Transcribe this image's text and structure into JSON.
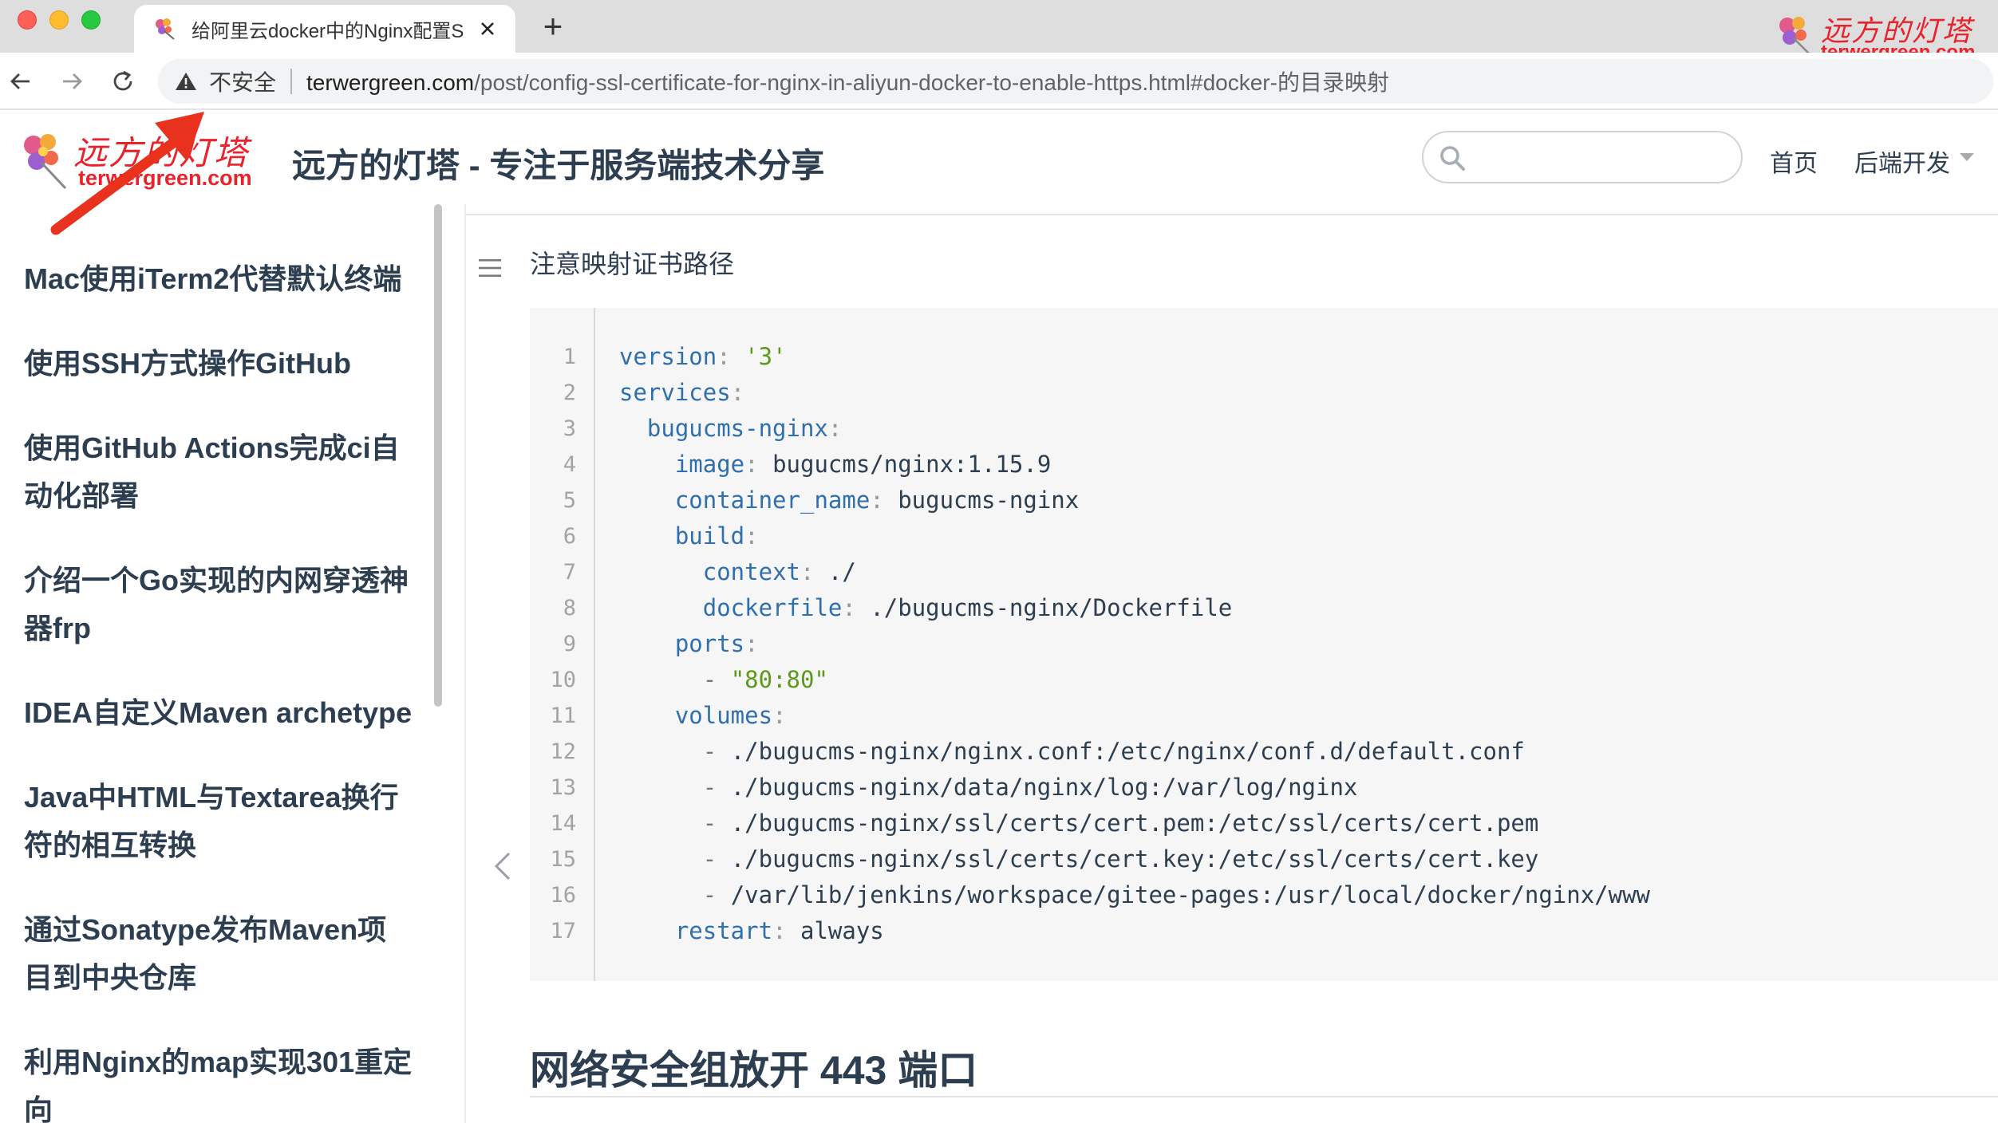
{
  "browser": {
    "tab": {
      "title": "给阿里云docker中的Nginx配置S"
    },
    "new_tab": "+",
    "brand": {
      "cn": "远方的灯塔",
      "en": "terwergreen.com"
    },
    "address": {
      "security_label": "不安全",
      "host": "terwergreen.com",
      "path": "/post/config-ssl-certificate-for-nginx-in-aliyun-docker-to-enable-https.html#docker-的目录映射"
    }
  },
  "site": {
    "logo": {
      "cn": "远方的灯塔",
      "en": "terwergreen.com"
    },
    "title": "远方的灯塔 - 专注于服务端技术分享",
    "search": {
      "placeholder": ""
    },
    "nav": [
      {
        "label": "首页"
      },
      {
        "label": "后端开发"
      }
    ]
  },
  "sidebar": {
    "items": [
      {
        "lines": [
          "Mac使用iTerm2代替默认终端"
        ]
      },
      {
        "lines": [
          "使用SSH方式操作GitHub"
        ]
      },
      {
        "lines": [
          "使用GitHub Actions完成ci自",
          "动化部署"
        ]
      },
      {
        "lines": [
          "介绍一个Go实现的内网穿透神",
          "器frp"
        ]
      },
      {
        "lines": [
          "IDEA自定义Maven archetype"
        ]
      },
      {
        "lines": [
          "Java中HTML与Textarea换行",
          "符的相互转换"
        ]
      },
      {
        "lines": [
          "通过Sonatype发布Maven项",
          "目到中央仓库"
        ]
      },
      {
        "lines": [
          "利用Nginx的map实现301重定",
          "向"
        ]
      }
    ]
  },
  "content": {
    "note": "注意映射证书路径",
    "code": [
      {
        "n": "1",
        "indent": "",
        "key": "version",
        "value": "'3'",
        "vtype": "string"
      },
      {
        "n": "2",
        "indent": "",
        "key": "services",
        "value": "",
        "vtype": "plain"
      },
      {
        "n": "3",
        "indent": "  ",
        "key": "bugucms-nginx",
        "value": "",
        "vtype": "plain"
      },
      {
        "n": "4",
        "indent": "    ",
        "key": "image",
        "value": "bugucms/nginx:1.15.9",
        "vtype": "plain"
      },
      {
        "n": "5",
        "indent": "    ",
        "key": "container_name",
        "value": "bugucms-nginx",
        "vtype": "plain"
      },
      {
        "n": "6",
        "indent": "    ",
        "key": "build",
        "value": "",
        "vtype": "plain"
      },
      {
        "n": "7",
        "indent": "      ",
        "key": "context",
        "value": "./",
        "vtype": "plain"
      },
      {
        "n": "8",
        "indent": "      ",
        "key": "dockerfile",
        "value": "./bugucms-nginx/Dockerfile",
        "vtype": "plain"
      },
      {
        "n": "9",
        "indent": "    ",
        "key": "ports",
        "value": "",
        "vtype": "plain"
      },
      {
        "n": "10",
        "indent": "      ",
        "dash": true,
        "value": "\"80:80\"",
        "vtype": "string"
      },
      {
        "n": "11",
        "indent": "    ",
        "key": "volumes",
        "value": "",
        "vtype": "plain"
      },
      {
        "n": "12",
        "indent": "      ",
        "dash": true,
        "value": "./bugucms-nginx/nginx.conf:/etc/nginx/conf.d/default.conf",
        "vtype": "plain"
      },
      {
        "n": "13",
        "indent": "      ",
        "dash": true,
        "value": "./bugucms-nginx/data/nginx/log:/var/log/nginx",
        "vtype": "plain"
      },
      {
        "n": "14",
        "indent": "      ",
        "dash": true,
        "value": "./bugucms-nginx/ssl/certs/cert.pem:/etc/ssl/certs/cert.pem",
        "vtype": "plain"
      },
      {
        "n": "15",
        "indent": "      ",
        "dash": true,
        "value": "./bugucms-nginx/ssl/certs/cert.key:/etc/ssl/certs/cert.key",
        "vtype": "plain"
      },
      {
        "n": "16",
        "indent": "      ",
        "dash": true,
        "value": "/var/lib/jenkins/workspace/gitee-pages:/usr/local/docker/nginx/www",
        "vtype": "plain"
      },
      {
        "n": "17",
        "indent": "    ",
        "key": "restart",
        "value": "always",
        "vtype": "plain"
      }
    ],
    "heading": "网络安全组放开 443 端口"
  },
  "icons": {
    "back": "arrow-left-icon",
    "forward": "arrow-right-icon",
    "reload": "reload-icon",
    "warning": "warning-triangle-icon",
    "search": "search-icon",
    "toc": "menu-lines-icon",
    "collapse": "chevron-left-icon",
    "annotation": "red-arrow-icon"
  },
  "colors": {
    "accent_red": "#e8232b",
    "heading": "#2c3e50",
    "code_key": "#2f6fae",
    "code_string": "#5a9a1b",
    "code_bg": "#f6f6f6"
  }
}
